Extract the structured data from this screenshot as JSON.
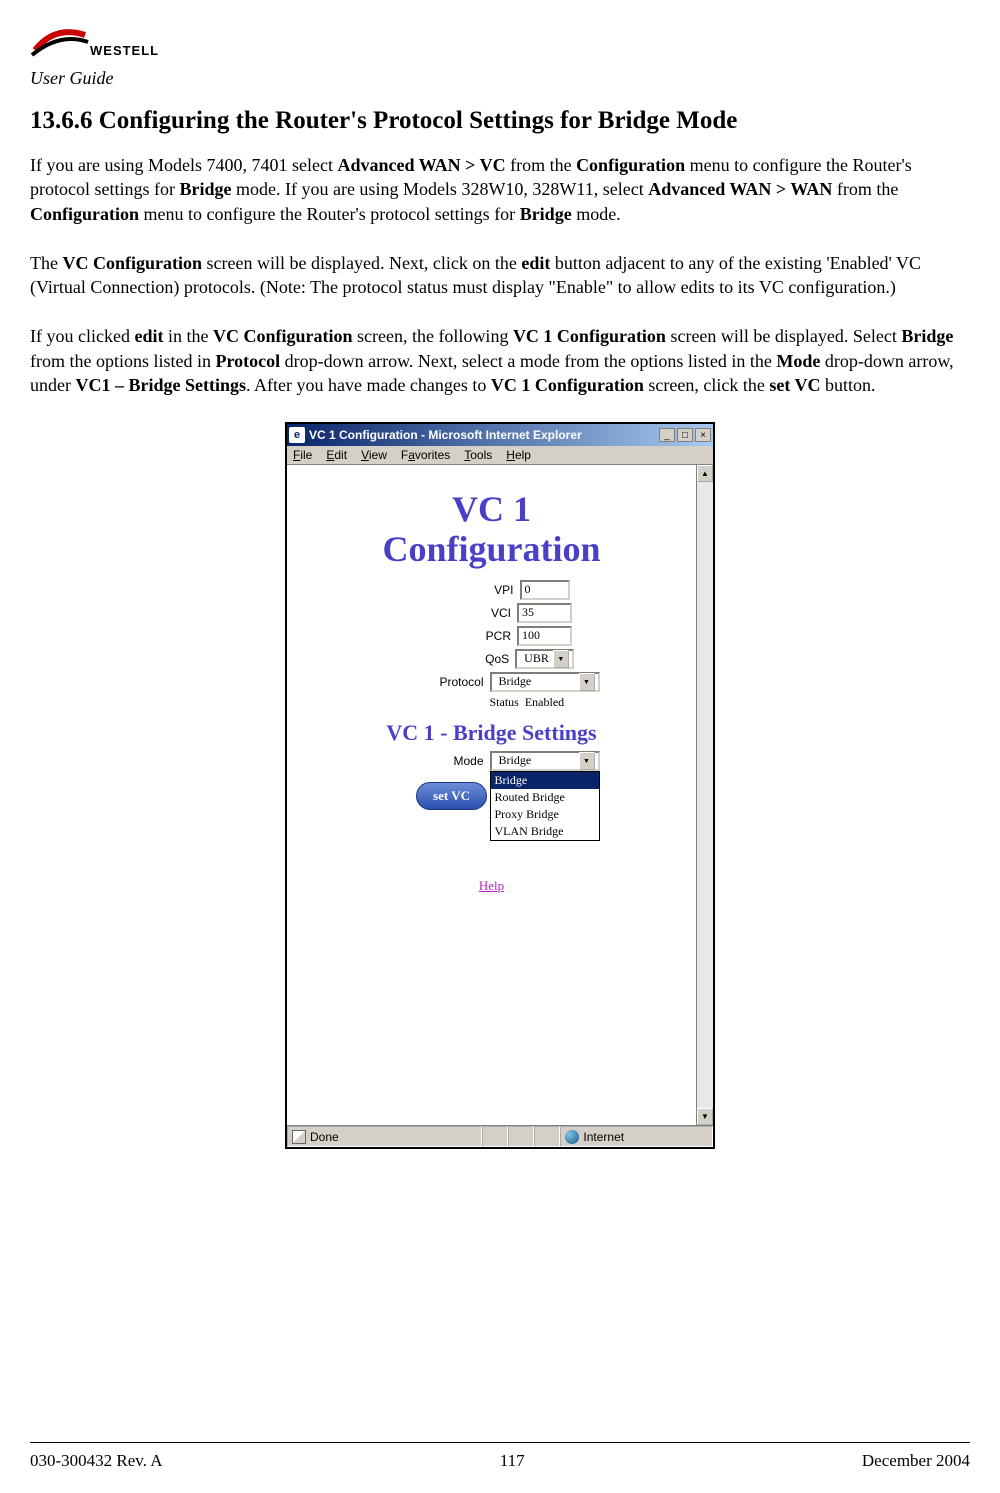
{
  "header": {
    "logo_brand": "WESTELL",
    "user_guide": "User Guide"
  },
  "section": {
    "number": "13.6.6",
    "title": "Configuring the Router's Protocol Settings for Bridge Mode"
  },
  "para1": {
    "p1": "If you are using Models 7400, 7401 select ",
    "b1": "Advanced WAN > VC",
    "p2": " from the ",
    "b2": "Configuration",
    "p3": " menu to configure the Router's protocol settings for ",
    "b3": "Bridge",
    "p4": " mode. If you are using Models 328W10, 328W11, select ",
    "b4": "Advanced WAN > WAN",
    "p5": " from the ",
    "b5": "Configuration",
    "p6": " menu to configure the Router's protocol settings for ",
    "b6": "Bridge",
    "p7": " mode."
  },
  "para2": {
    "p1": "The ",
    "b1": "VC Configuration",
    "p2": " screen will be displayed. Next, click on the ",
    "b2": "edit",
    "p3": " button adjacent to any of the existing 'Enabled' VC (Virtual Connection) protocols. (Note: The protocol status must display \"Enable\" to allow edits to its VC configuration.)"
  },
  "para3": {
    "p1": "If you clicked ",
    "b1": "edit",
    "p2": " in the ",
    "b2": "VC Configuration",
    "p3": " screen, the following ",
    "b3": "VC 1 Configuration",
    "p4": " screen will be displayed. Select ",
    "b4": "Bridge",
    "p5": " from the options listed in ",
    "b5": "Protocol",
    "p6": " drop-down arrow. Next, select a mode from the options listed in the ",
    "b6": "Mode",
    "p7": " drop-down arrow, under ",
    "b7": "VC1 – Bridge Settings",
    "p8": ". After you have made changes to ",
    "b8": "VC 1 Configuration",
    "p9": " screen, click the ",
    "b9": "set VC",
    "p10": " button."
  },
  "browser": {
    "title": "VC 1 Configuration - Microsoft Internet Explorer",
    "menu": {
      "file": "File",
      "edit": "Edit",
      "view": "View",
      "favorites": "Favorites",
      "tools": "Tools",
      "help": "Help"
    },
    "page_title_l1": "VC 1",
    "page_title_l2": "Configuration",
    "labels": {
      "vpi": "VPI",
      "vci": "VCI",
      "pcr": "PCR",
      "qos": "QoS",
      "protocol": "Protocol",
      "status": "Status",
      "mode": "Mode"
    },
    "values": {
      "vpi": "0",
      "vci": "35",
      "pcr": "100",
      "qos": "UBR",
      "protocol": "Bridge",
      "status": "Enabled",
      "mode": "Bridge"
    },
    "bridge_title": "VC 1 - Bridge Settings",
    "mode_options": [
      "Bridge",
      "Routed Bridge",
      "Proxy Bridge",
      "VLAN Bridge"
    ],
    "set_vc_label": "set VC",
    "help_label": "Help",
    "done": "Done",
    "internet": "Internet"
  },
  "footer": {
    "left": "030-300432 Rev. A",
    "center": "117",
    "right": "December 2004"
  }
}
